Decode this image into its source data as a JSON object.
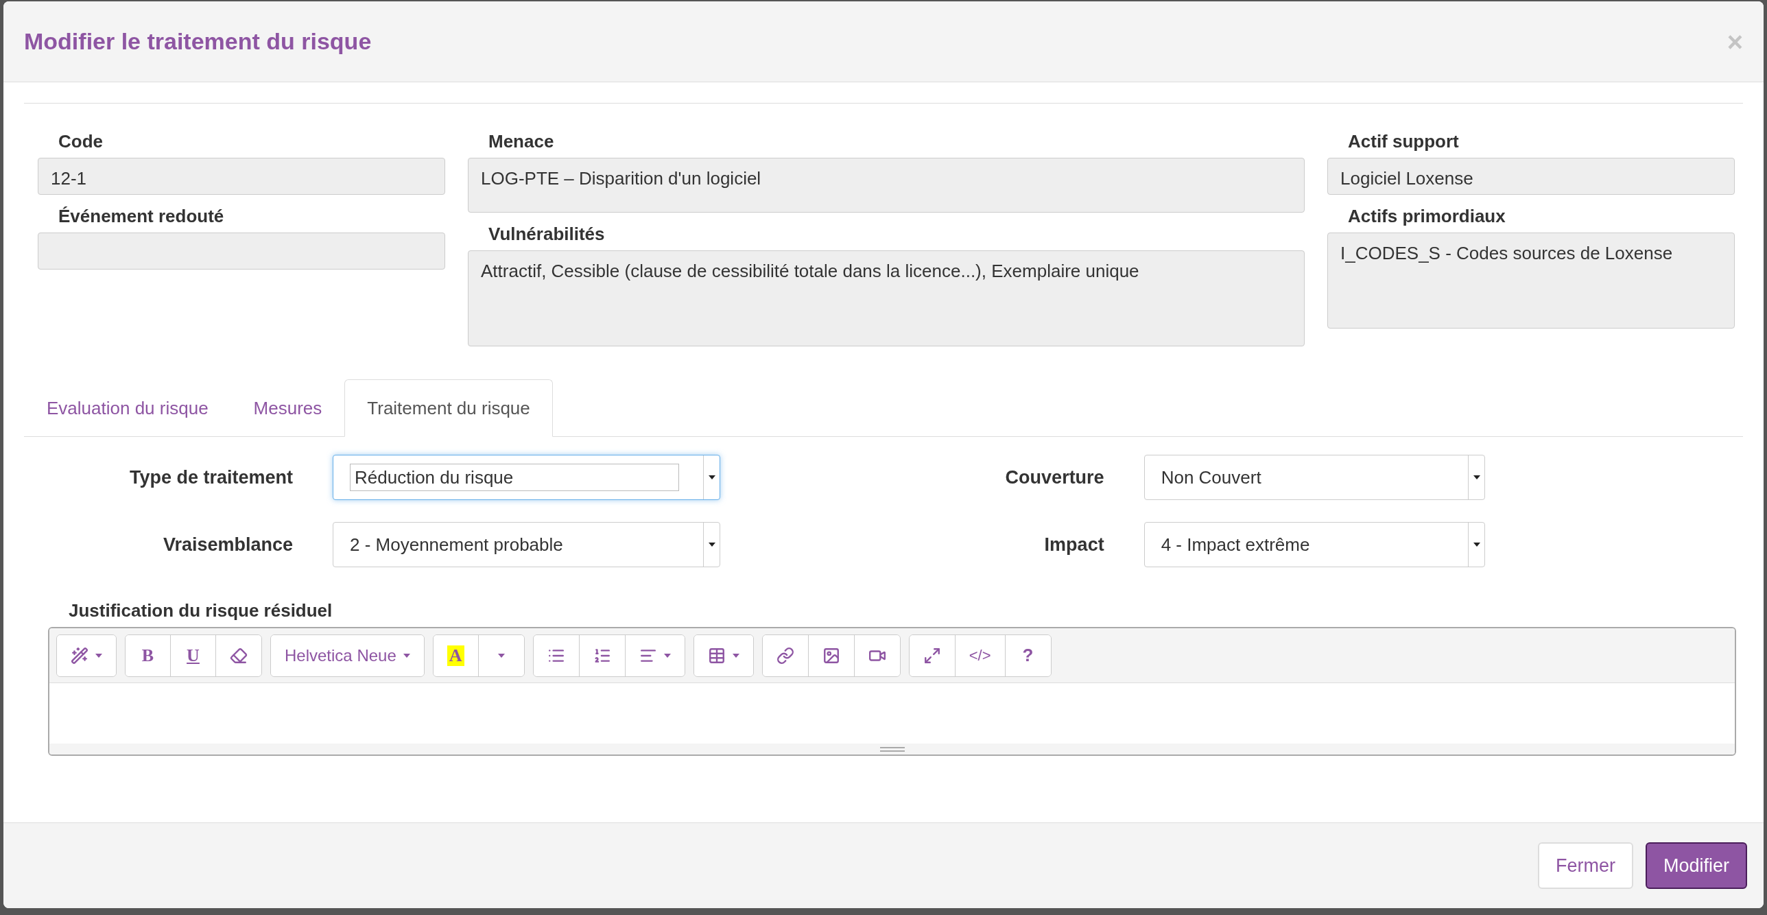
{
  "dialog": {
    "title": "Modifier le traitement du risque",
    "close": "×"
  },
  "info_columns": [
    [
      {
        "label": "Code",
        "value": "12-1"
      },
      {
        "label": "Événement redouté"
      }
    ],
    [
      {
        "label": "Menace",
        "value": "LOG-PTE – Disparition d'un logiciel"
      },
      {
        "label": "Vulnérabilités",
        "value": "Attractif, Cessible (clause de cessibilité totale dans la licence...), Exemplaire unique"
      }
    ],
    [
      {
        "label": "Actif support",
        "value": "Logiciel Loxense"
      },
      {
        "label": "Actifs primordiaux",
        "value": "I_CODES_S - Codes sources de Loxense"
      }
    ]
  ],
  "tabs": [
    {
      "label": "Evaluation du risque",
      "selected": false
    },
    {
      "label": "Mesures",
      "selected": false
    },
    {
      "label": "Traitement du risque",
      "selected": true
    }
  ],
  "form": [
    {
      "label": "Type de traitement",
      "value": "Réduction du risque",
      "focused": true
    },
    {
      "label": "Couverture",
      "value": "Non Couvert",
      "focused": false
    },
    {
      "label": "Vraisemblance",
      "value": "2 - Moyennement probable",
      "focused": false
    },
    {
      "label": "Impact",
      "value": "4 - Impact extrême",
      "focused": false
    }
  ],
  "editor": {
    "label": "Justification du risque résiduel",
    "toolbar": [
      [
        {
          "kind": "magic",
          "caret": true
        }
      ],
      [
        {
          "kind": "bold",
          "label": "B"
        },
        {
          "kind": "underline",
          "label": "U"
        },
        {
          "kind": "eraser"
        }
      ],
      [
        {
          "kind": "font",
          "label": "Helvetica Neue",
          "caret": true
        }
      ],
      [
        {
          "kind": "color",
          "label": "A"
        },
        {
          "kind": "dropdown",
          "caret": true
        }
      ],
      [
        {
          "kind": "ul"
        },
        {
          "kind": "ol"
        },
        {
          "kind": "align",
          "caret": true
        }
      ],
      [
        {
          "kind": "table",
          "caret": true
        }
      ],
      [
        {
          "kind": "link"
        },
        {
          "kind": "image"
        },
        {
          "kind": "video"
        }
      ],
      [
        {
          "kind": "fullscreen"
        },
        {
          "kind": "code",
          "label": "</>"
        },
        {
          "kind": "help",
          "label": "?"
        }
      ]
    ]
  },
  "buttons": [
    {
      "label": "Fermer",
      "primary": false
    },
    {
      "label": "Modifier",
      "primary": true
    }
  ]
}
